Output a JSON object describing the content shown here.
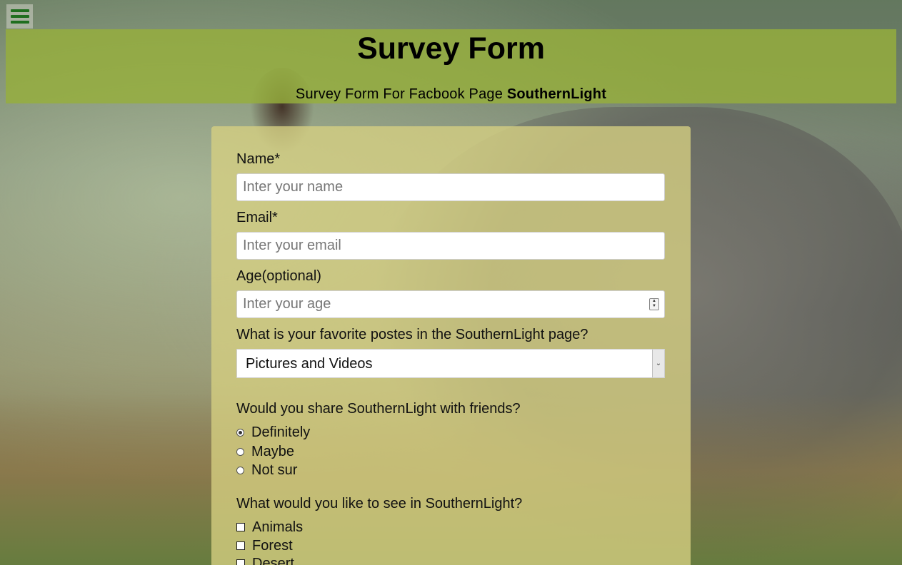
{
  "menu": {
    "icon": "hamburger-menu-icon"
  },
  "header": {
    "title": "Survey Form",
    "subtitle_prefix": "Survey Form For Facbook Page ",
    "subtitle_brand": "SouthernLight"
  },
  "form": {
    "name": {
      "label": "Name*",
      "placeholder": "Inter your name"
    },
    "email": {
      "label": "Email*",
      "placeholder": "Inter your email"
    },
    "age": {
      "label": "Age(optional)",
      "placeholder": "Inter your age"
    },
    "favorite_posts": {
      "label": "What is your favorite postes in the SouthernLight page?",
      "selected": "Pictures and Videos"
    },
    "share": {
      "question": "Would you share SouthernLight with friends?",
      "options": [
        {
          "label": "Definitely",
          "checked": true
        },
        {
          "label": "Maybe",
          "checked": false
        },
        {
          "label": "Not sur",
          "checked": false
        }
      ]
    },
    "interests": {
      "question": "What would you like to see in SouthernLight?",
      "options": [
        {
          "label": "Animals",
          "checked": false
        },
        {
          "label": "Forest",
          "checked": false
        },
        {
          "label": "Desert",
          "checked": false
        }
      ]
    }
  },
  "colors": {
    "banner": "#96af3c",
    "card": "#d6d082",
    "menu_icon": "#1f6e1f"
  }
}
